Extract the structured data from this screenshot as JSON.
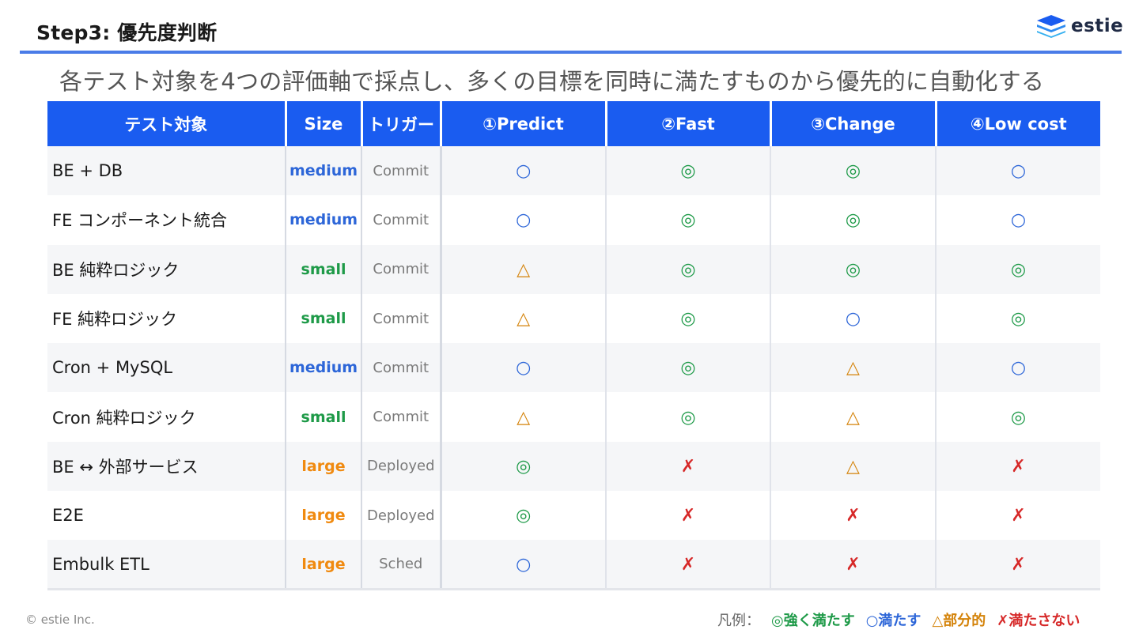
{
  "header": {
    "title": "Step3: 優先度判断",
    "logo_text": "estie",
    "subtitle": "各テスト対象を4つの評価軸で採点し、多くの目標を同時に満たすものから優先的に自動化する"
  },
  "colors": {
    "accent_blue": "#1a5cf0",
    "header_line": "#4a7ce8",
    "strong": "#1e9a48",
    "meets": "#2d66d8",
    "partial": "#d4830a",
    "not_met": "#d62828",
    "size_medium": "#2d66d8",
    "size_small": "#1e9a48",
    "size_large": "#f08a10"
  },
  "table": {
    "headers": [
      "テスト対象",
      "Size",
      "トリガー",
      "①Predict",
      "②Fast",
      "③Change",
      "④Low cost"
    ],
    "rows": [
      {
        "name": "BE + DB",
        "size": "medium",
        "trigger": "Commit",
        "scores": [
          "○",
          "◎",
          "◎",
          "○"
        ]
      },
      {
        "name": "FE コンポーネント統合",
        "size": "medium",
        "trigger": "Commit",
        "scores": [
          "○",
          "◎",
          "◎",
          "○"
        ]
      },
      {
        "name": "BE 純粋ロジック",
        "size": "small",
        "trigger": "Commit",
        "scores": [
          "△",
          "◎",
          "◎",
          "◎"
        ]
      },
      {
        "name": "FE 純粋ロジック",
        "size": "small",
        "trigger": "Commit",
        "scores": [
          "△",
          "◎",
          "○",
          "◎"
        ]
      },
      {
        "name": "Cron + MySQL",
        "size": "medium",
        "trigger": "Commit",
        "scores": [
          "○",
          "◎",
          "△",
          "○"
        ]
      },
      {
        "name": "Cron 純粋ロジック",
        "size": "small",
        "trigger": "Commit",
        "scores": [
          "△",
          "◎",
          "△",
          "◎"
        ]
      },
      {
        "name": "BE ↔ 外部サービス",
        "size": "large",
        "trigger": "Deployed",
        "scores": [
          "◎",
          "✗",
          "△",
          "✗"
        ]
      },
      {
        "name": "E2E",
        "size": "large",
        "trigger": "Deployed",
        "scores": [
          "◎",
          "✗",
          "✗",
          "✗"
        ]
      },
      {
        "name": "Embulk ETL",
        "size": "large",
        "trigger": "Sched",
        "scores": [
          "○",
          "✗",
          "✗",
          "✗"
        ]
      }
    ]
  },
  "legend": {
    "label": "凡例：",
    "strong": "◎強く満たす",
    "meets": "○満たす",
    "partial": "△部分的",
    "not_met": "✗満たさない"
  },
  "footer": {
    "copyright": "© estie Inc."
  }
}
